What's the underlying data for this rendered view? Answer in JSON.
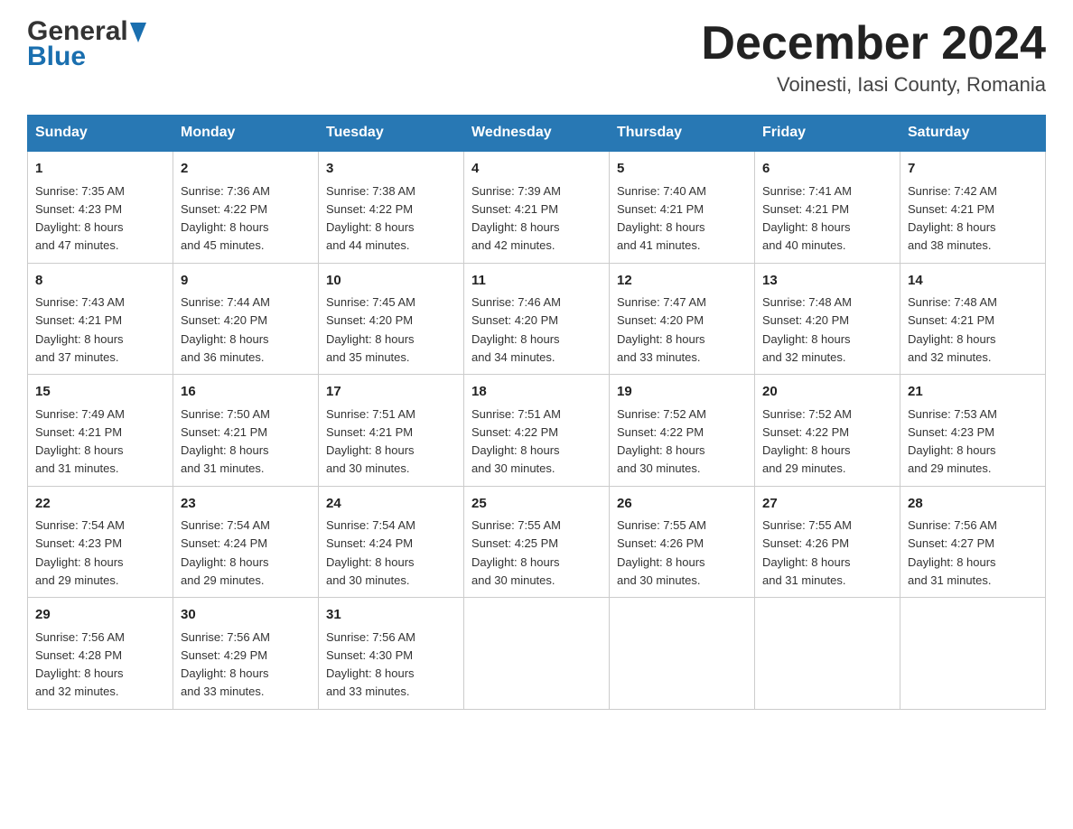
{
  "header": {
    "logo_general": "General",
    "logo_blue": "Blue",
    "month_title": "December 2024",
    "location": "Voinesti, Iasi County, Romania"
  },
  "days_of_week": [
    "Sunday",
    "Monday",
    "Tuesday",
    "Wednesday",
    "Thursday",
    "Friday",
    "Saturday"
  ],
  "weeks": [
    [
      {
        "day": "1",
        "sunrise": "7:35 AM",
        "sunset": "4:23 PM",
        "daylight": "8 hours and 47 minutes."
      },
      {
        "day": "2",
        "sunrise": "7:36 AM",
        "sunset": "4:22 PM",
        "daylight": "8 hours and 45 minutes."
      },
      {
        "day": "3",
        "sunrise": "7:38 AM",
        "sunset": "4:22 PM",
        "daylight": "8 hours and 44 minutes."
      },
      {
        "day": "4",
        "sunrise": "7:39 AM",
        "sunset": "4:21 PM",
        "daylight": "8 hours and 42 minutes."
      },
      {
        "day": "5",
        "sunrise": "7:40 AM",
        "sunset": "4:21 PM",
        "daylight": "8 hours and 41 minutes."
      },
      {
        "day": "6",
        "sunrise": "7:41 AM",
        "sunset": "4:21 PM",
        "daylight": "8 hours and 40 minutes."
      },
      {
        "day": "7",
        "sunrise": "7:42 AM",
        "sunset": "4:21 PM",
        "daylight": "8 hours and 38 minutes."
      }
    ],
    [
      {
        "day": "8",
        "sunrise": "7:43 AM",
        "sunset": "4:21 PM",
        "daylight": "8 hours and 37 minutes."
      },
      {
        "day": "9",
        "sunrise": "7:44 AM",
        "sunset": "4:20 PM",
        "daylight": "8 hours and 36 minutes."
      },
      {
        "day": "10",
        "sunrise": "7:45 AM",
        "sunset": "4:20 PM",
        "daylight": "8 hours and 35 minutes."
      },
      {
        "day": "11",
        "sunrise": "7:46 AM",
        "sunset": "4:20 PM",
        "daylight": "8 hours and 34 minutes."
      },
      {
        "day": "12",
        "sunrise": "7:47 AM",
        "sunset": "4:20 PM",
        "daylight": "8 hours and 33 minutes."
      },
      {
        "day": "13",
        "sunrise": "7:48 AM",
        "sunset": "4:20 PM",
        "daylight": "8 hours and 32 minutes."
      },
      {
        "day": "14",
        "sunrise": "7:48 AM",
        "sunset": "4:21 PM",
        "daylight": "8 hours and 32 minutes."
      }
    ],
    [
      {
        "day": "15",
        "sunrise": "7:49 AM",
        "sunset": "4:21 PM",
        "daylight": "8 hours and 31 minutes."
      },
      {
        "day": "16",
        "sunrise": "7:50 AM",
        "sunset": "4:21 PM",
        "daylight": "8 hours and 31 minutes."
      },
      {
        "day": "17",
        "sunrise": "7:51 AM",
        "sunset": "4:21 PM",
        "daylight": "8 hours and 30 minutes."
      },
      {
        "day": "18",
        "sunrise": "7:51 AM",
        "sunset": "4:22 PM",
        "daylight": "8 hours and 30 minutes."
      },
      {
        "day": "19",
        "sunrise": "7:52 AM",
        "sunset": "4:22 PM",
        "daylight": "8 hours and 30 minutes."
      },
      {
        "day": "20",
        "sunrise": "7:52 AM",
        "sunset": "4:22 PM",
        "daylight": "8 hours and 29 minutes."
      },
      {
        "day": "21",
        "sunrise": "7:53 AM",
        "sunset": "4:23 PM",
        "daylight": "8 hours and 29 minutes."
      }
    ],
    [
      {
        "day": "22",
        "sunrise": "7:54 AM",
        "sunset": "4:23 PM",
        "daylight": "8 hours and 29 minutes."
      },
      {
        "day": "23",
        "sunrise": "7:54 AM",
        "sunset": "4:24 PM",
        "daylight": "8 hours and 29 minutes."
      },
      {
        "day": "24",
        "sunrise": "7:54 AM",
        "sunset": "4:24 PM",
        "daylight": "8 hours and 30 minutes."
      },
      {
        "day": "25",
        "sunrise": "7:55 AM",
        "sunset": "4:25 PM",
        "daylight": "8 hours and 30 minutes."
      },
      {
        "day": "26",
        "sunrise": "7:55 AM",
        "sunset": "4:26 PM",
        "daylight": "8 hours and 30 minutes."
      },
      {
        "day": "27",
        "sunrise": "7:55 AM",
        "sunset": "4:26 PM",
        "daylight": "8 hours and 31 minutes."
      },
      {
        "day": "28",
        "sunrise": "7:56 AM",
        "sunset": "4:27 PM",
        "daylight": "8 hours and 31 minutes."
      }
    ],
    [
      {
        "day": "29",
        "sunrise": "7:56 AM",
        "sunset": "4:28 PM",
        "daylight": "8 hours and 32 minutes."
      },
      {
        "day": "30",
        "sunrise": "7:56 AM",
        "sunset": "4:29 PM",
        "daylight": "8 hours and 33 minutes."
      },
      {
        "day": "31",
        "sunrise": "7:56 AM",
        "sunset": "4:30 PM",
        "daylight": "8 hours and 33 minutes."
      },
      null,
      null,
      null,
      null
    ]
  ],
  "labels": {
    "sunrise": "Sunrise:",
    "sunset": "Sunset:",
    "daylight": "Daylight:"
  }
}
